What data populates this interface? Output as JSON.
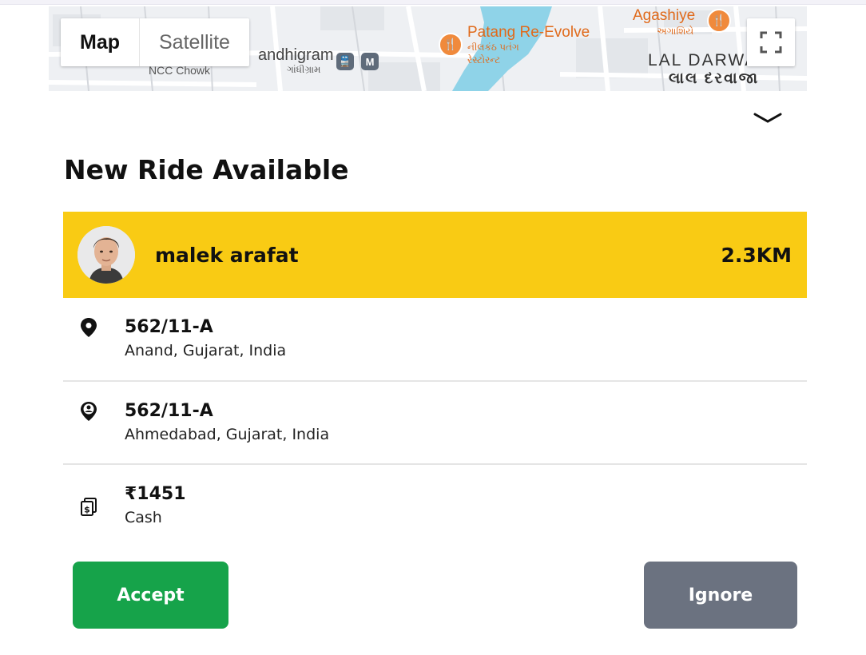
{
  "map": {
    "type_buttons": {
      "map": "Map",
      "satellite": "Satellite"
    },
    "labels": {
      "agashiye": "Agashiye",
      "agashiye_gu": "અગાશિયે",
      "patang": "Patang Re-Evolve",
      "patang_gu1": "નીલકંઠ પતંગ",
      "patang_gu2": "રેસ્ટોરન્ટ",
      "gandhigram": "andhigram",
      "gandhigram_gu": "ગાંધીગ્રામ",
      "ncc": "NCC Chowk",
      "lal_darwaja": "LAL DARWAJA",
      "lal_darwaja_gu": "લાલ દરવાજા",
      "metro": "M"
    }
  },
  "title": "New Ride Available",
  "rider": {
    "name": "malek arafat",
    "distance": "2.3KM"
  },
  "pickup": {
    "title": "562/11-A",
    "address": "Anand, Gujarat, India",
    "icon": "map-pin-icon"
  },
  "dropoff": {
    "title": "562/11-A",
    "address": "Ahmedabad, Gujarat, India",
    "icon": "person-pin-icon"
  },
  "payment": {
    "amount": "₹1451",
    "method": "Cash",
    "icon": "cash-icon"
  },
  "actions": {
    "accept": "Accept",
    "ignore": "Ignore"
  },
  "colors": {
    "rider_bg": "#f9cb14",
    "accept": "#16a34a",
    "ignore": "#6b7280",
    "river": "#8fd3e8"
  }
}
